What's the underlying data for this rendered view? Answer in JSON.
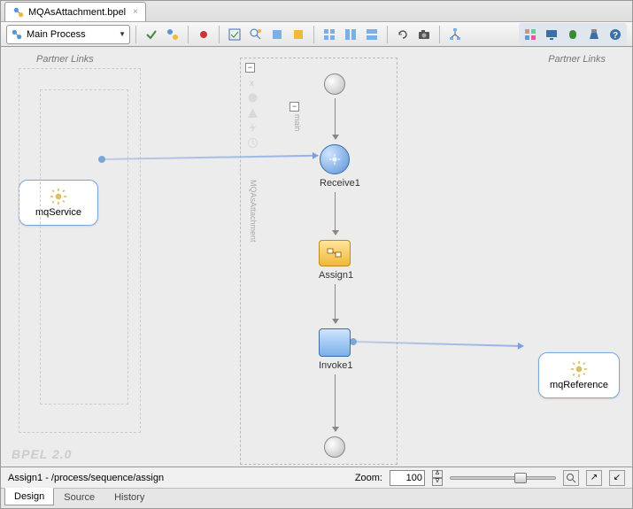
{
  "tab": {
    "filename": "MQAsAttachment.bpel"
  },
  "toolbar": {
    "scopeLabel": "Main Process"
  },
  "canvas": {
    "partnerLinksLabel": "Partner Links",
    "leftPartner": "mqService",
    "rightPartner": "mqReference",
    "swimlaneMain": "main",
    "swimlaneProcess": "MQAsAttachment",
    "collapseGlyph": "−",
    "nodes": {
      "receive": "Receive1",
      "assign": "Assign1",
      "invoke": "Invoke1"
    },
    "watermark": "BPEL 2.0"
  },
  "status": {
    "breadcrumb": "Assign1 - /process/sequence/assign",
    "zoomLabel": "Zoom:",
    "zoomValue": "100"
  },
  "bottomTabs": {
    "design": "Design",
    "source": "Source",
    "history": "History"
  }
}
